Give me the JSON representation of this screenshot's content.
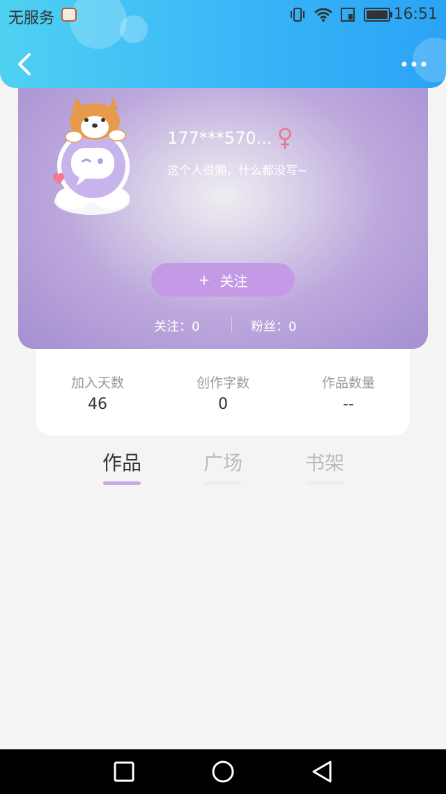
{
  "status_bar": {
    "carrier": "无服务",
    "time": "16:51"
  },
  "header": {
    "back_icon": "chevron-left-icon",
    "more_icon": "more-dots-icon"
  },
  "profile": {
    "username": "177***570...",
    "gender_icon": "female-icon",
    "bio": "这个人很懒，什么都没写~",
    "follow_plus": "+",
    "follow_label": "关注",
    "following": "关注：0",
    "fans": "粉丝：0"
  },
  "stats": [
    {
      "label": "加入天数",
      "value": "46"
    },
    {
      "label": "创作字数",
      "value": "0"
    },
    {
      "label": "作品数量",
      "value": "--"
    }
  ],
  "tabs": [
    {
      "label": "作品",
      "active": true
    },
    {
      "label": "广场",
      "active": false
    },
    {
      "label": "书架",
      "active": false
    }
  ],
  "colors": {
    "header": "#38b6f7",
    "card": "#a58fd2",
    "accent": "#c49ae6"
  }
}
